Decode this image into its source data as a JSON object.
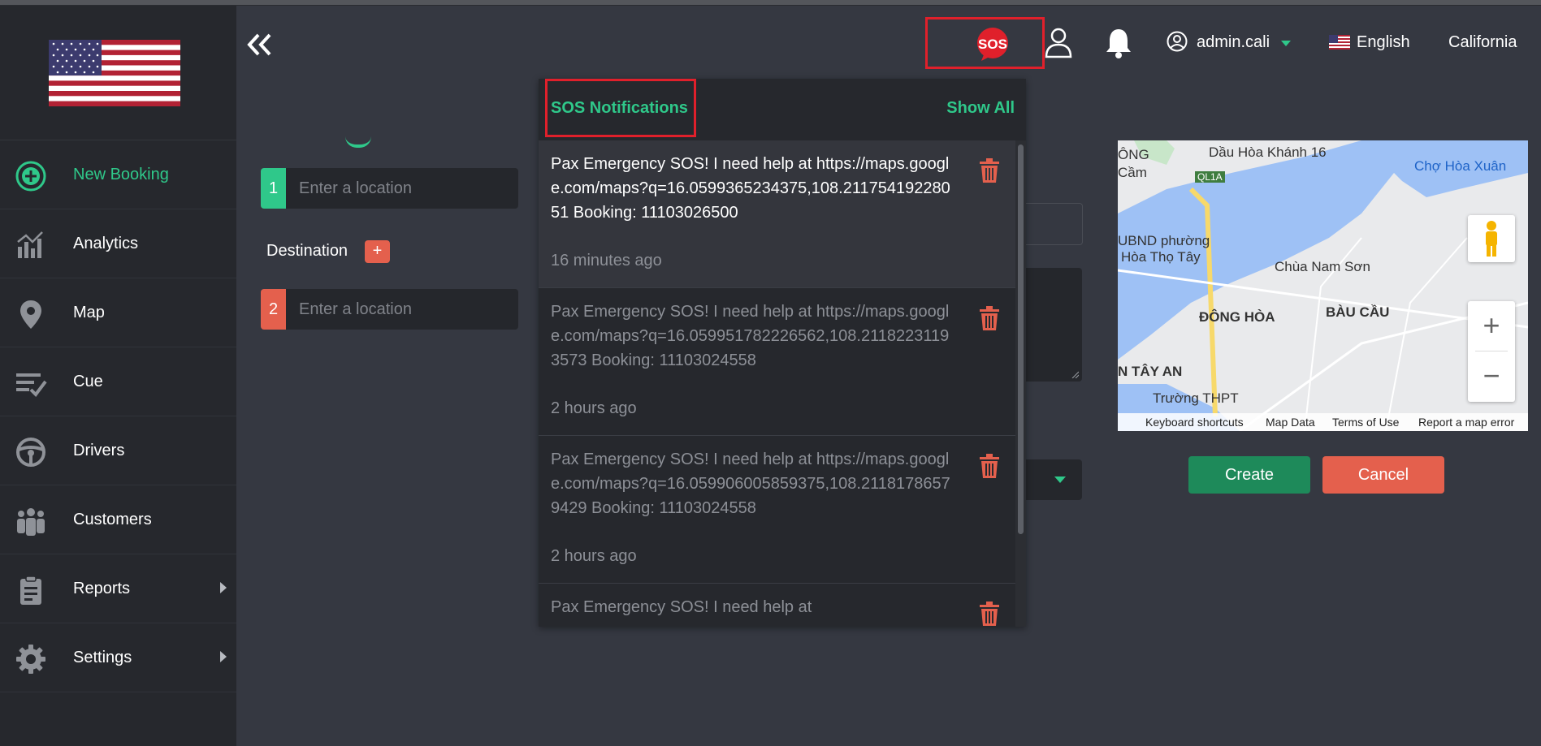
{
  "header": {
    "account_name": "admin.cali",
    "language": "English",
    "region": "California"
  },
  "sidebar": {
    "items": [
      {
        "label": "New Booking"
      },
      {
        "label": "Analytics"
      },
      {
        "label": "Map"
      },
      {
        "label": "Cue"
      },
      {
        "label": "Drivers"
      },
      {
        "label": "Customers"
      },
      {
        "label": "Reports"
      },
      {
        "label": "Settings"
      }
    ]
  },
  "booking": {
    "pickup_number": "1",
    "pickup_placeholder": "Enter a location",
    "destination_label": "Destination",
    "destination_add": "+",
    "destination_number": "2",
    "destination_placeholder": "Enter a location"
  },
  "sos_panel": {
    "title": "SOS Notifications",
    "show_all": "Show All",
    "notifications": [
      {
        "message": "Pax Emergency SOS! I need help at https://maps.google.com/maps?q=16.0599365234375,108.21175419228051 Booking: 11103026500",
        "time": "16 minutes ago"
      },
      {
        "message": "Pax Emergency SOS! I need help at https://maps.google.com/maps?q=16.059951782226562,108.21182231193573 Booking: 11103024558",
        "time": "2 hours ago"
      },
      {
        "message": "Pax Emergency SOS! I need help at https://maps.google.com/maps?q=16.059906005859375,108.21181786579429 Booking: 11103024558",
        "time": "2 hours ago"
      },
      {
        "message": "Pax Emergency SOS! I need help at",
        "time": ""
      }
    ]
  },
  "map": {
    "labels": [
      "Dầu Hòa Khánh 16",
      "Chợ Hòa Xuân",
      "ÔNG",
      "Cầm",
      "QL1A",
      "UBND phường",
      "Hòa Thọ Tây",
      "Chùa Nam Sơn",
      "ĐÔNG HÒA",
      "BÀU CẦU",
      "N TÂY AN",
      "Trường THPT"
    ],
    "footer": [
      "Keyboard shortcuts",
      "Map Data",
      "Terms of Use",
      "Report a map error"
    ]
  },
  "actions": {
    "create": "Create",
    "cancel": "Cancel"
  }
}
